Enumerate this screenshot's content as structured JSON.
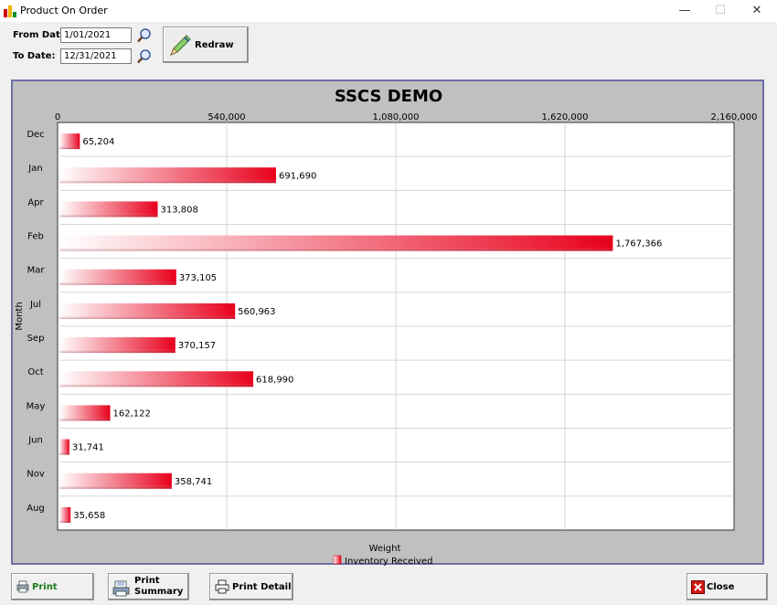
{
  "window": {
    "title": "Product On Order",
    "minimize": "—",
    "maximize": "☐",
    "close": "✕"
  },
  "filters": {
    "from_label": "From Date:",
    "from_value": "1/01/2021",
    "to_label": "To Date:",
    "to_value": "12/31/2021",
    "redraw_label": "Redraw"
  },
  "buttons": {
    "print": "Print",
    "print_summary_line1": "Print",
    "print_summary_line2": "Summary",
    "print_detail": "Print Detail",
    "close": "Close"
  },
  "colors": {
    "bar": "#e8001c",
    "frame": "#6f6fa9",
    "panel": "#c0c0c0"
  },
  "chart_data": {
    "type": "bar",
    "orientation": "horizontal",
    "title": "SSCS DEMO",
    "xlabel": "Weight",
    "ylabel": "Month",
    "xlim": [
      0,
      2160000
    ],
    "xticks": [
      0,
      540000,
      1080000,
      1620000,
      2160000
    ],
    "xtick_labels": [
      "0",
      "540,000",
      "1,080,000",
      "1,620,000",
      "2,160,000"
    ],
    "grid": true,
    "legend_position": "bottom",
    "categories": [
      "Dec",
      "Jan",
      "Apr",
      "Feb",
      "Mar",
      "Jul",
      "Sep",
      "Oct",
      "May",
      "Jun",
      "Nov",
      "Aug"
    ],
    "series": [
      {
        "name": "Inventory Received",
        "values": [
          65204,
          691690,
          313808,
          1767366,
          373105,
          560963,
          370157,
          618990,
          162122,
          31741,
          358741,
          35658
        ],
        "labels": [
          "65,204",
          "691,690",
          "313,808",
          "1,767,366",
          "373,105",
          "560,963",
          "370,157",
          "618,990",
          "162,122",
          "31,741",
          "358,741",
          "35,658"
        ]
      }
    ]
  }
}
